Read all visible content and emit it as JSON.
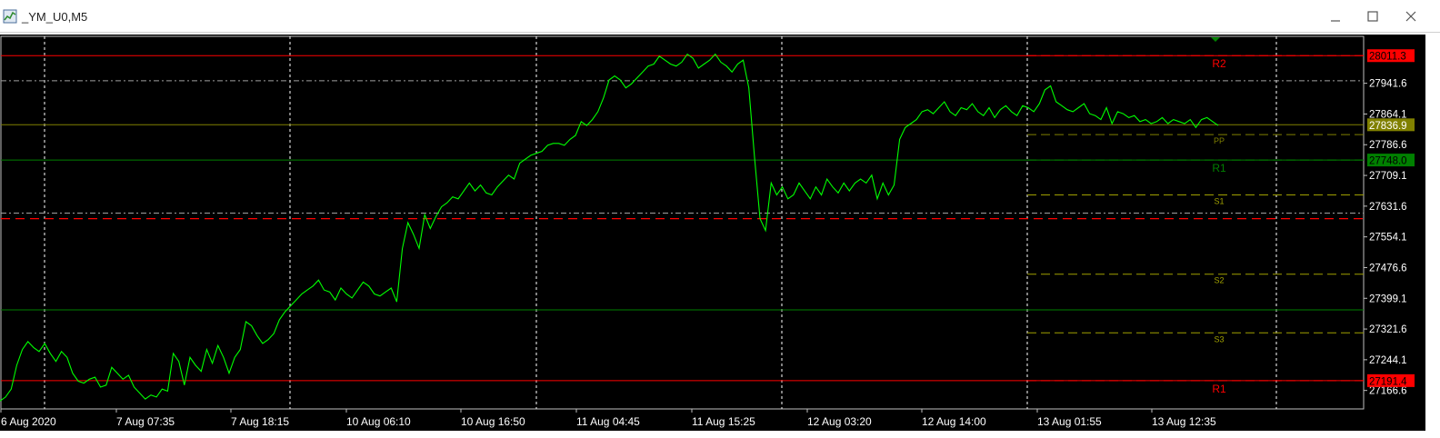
{
  "window": {
    "title": "_YM_U0,M5",
    "controls": {
      "minimize": "minimize",
      "maximize": "maximize",
      "close": "close"
    }
  },
  "colors": {
    "background": "#000000",
    "price_line": "#00ff00",
    "grid": "#ffffff",
    "resistance": "#ff0000",
    "support": "#008000",
    "pivot": "#808000",
    "fib": "#a0a000"
  },
  "chart_data": {
    "type": "line",
    "symbol": "_YM_U0",
    "timeframe": "M5",
    "ylim": [
      27120,
      28060
    ],
    "price_axis_ticks": [
      "27941.6",
      "27864.1",
      "27786.6",
      "27709.1",
      "27631.6",
      "27554.1",
      "27476.6",
      "27399.1",
      "27321.6",
      "27244.1",
      "27166.6"
    ],
    "price_tags": [
      {
        "text": "28011.3",
        "value": 28011.3,
        "color": "#ff0000",
        "text_color": "#000000"
      },
      {
        "text": "27836.9",
        "value": 27836.9,
        "color": "#808000",
        "text_color": "#ffffff"
      },
      {
        "text": "27748.0",
        "value": 27748.0,
        "color": "#008000",
        "text_color": "#000000"
      },
      {
        "text": "27191.4",
        "value": 27191.4,
        "color": "#ff0000",
        "text_color": "#000000"
      }
    ],
    "time_labels": [
      "6 Aug 2020",
      "7 Aug 07:35",
      "7 Aug 18:15",
      "10 Aug 06:10",
      "10 Aug 16:50",
      "11 Aug 04:45",
      "11 Aug 15:25",
      "12 Aug 03:20",
      "12 Aug 14:00",
      "13 Aug 01:55",
      "13 Aug 12:35"
    ],
    "horizontal_levels": [
      {
        "value": 28011.3,
        "color": "#ff0000",
        "style": "solid"
      },
      {
        "value": 27948,
        "color": "#a0a0a0",
        "style": "dashdot"
      },
      {
        "value": 27836.9,
        "color": "#808000",
        "style": "solid"
      },
      {
        "value": 27748.0,
        "color": "#008000",
        "style": "solid"
      },
      {
        "value": 27614,
        "color": "#a0a0a0",
        "style": "dashdot"
      },
      {
        "value": 27600,
        "color": "#ff0000",
        "style": "dashed"
      },
      {
        "value": 27370,
        "color": "#008000",
        "style": "solid"
      },
      {
        "value": 27191.4,
        "color": "#ff0000",
        "style": "solid"
      }
    ],
    "pivot_levels": [
      {
        "label": "R2",
        "value": 28011.3,
        "color": "#ff0000",
        "label_size": "large"
      },
      {
        "label": "PP",
        "value": 27812,
        "color": "#808000",
        "label_size": "small"
      },
      {
        "label": "R1",
        "value": 27748.0,
        "color": "#008000",
        "label_size": "large"
      },
      {
        "label": "S1",
        "value": 27660,
        "color": "#a0a000",
        "label_size": "small"
      },
      {
        "label": "S2",
        "value": 27460,
        "color": "#a0a000",
        "label_size": "small"
      },
      {
        "label": "S3",
        "value": 27312,
        "color": "#a0a000",
        "label_size": "small"
      },
      {
        "label": "R1",
        "value": 27191.4,
        "color": "#ff0000",
        "label_size": "large"
      }
    ],
    "series": [
      {
        "values": [
          27140,
          27150,
          27170,
          27230,
          27270,
          27290,
          27275,
          27265,
          27285,
          27260,
          27240,
          27265,
          27250,
          27210,
          27190,
          27185,
          27195,
          27200,
          27175,
          27180,
          27225,
          27210,
          27195,
          27205,
          27175,
          27160,
          27145,
          27155,
          27150,
          27170,
          27165,
          27260,
          27240,
          27180,
          27250,
          27230,
          27215,
          27270,
          27235,
          27280,
          27250,
          27210,
          27250,
          27270,
          27340,
          27330,
          27305,
          27285,
          27295,
          27310,
          27345,
          27365,
          27380,
          27395,
          27410,
          27420,
          27430,
          27445,
          27420,
          27415,
          27395,
          27425,
          27410,
          27400,
          27420,
          27440,
          27430,
          27410,
          27405,
          27415,
          27425,
          27390,
          27525,
          27590,
          27560,
          27525,
          27610,
          27575,
          27605,
          27630,
          27640,
          27655,
          27650,
          27670,
          27690,
          27670,
          27685,
          27665,
          27660,
          27680,
          27695,
          27710,
          27700,
          27740,
          27750,
          27760,
          27765,
          27770,
          27785,
          27790,
          27790,
          27785,
          27800,
          27810,
          27845,
          27835,
          27850,
          27870,
          27905,
          27950,
          27960,
          27950,
          27930,
          27940,
          27955,
          27970,
          27985,
          27990,
          28010,
          28000,
          27990,
          27985,
          27995,
          28015,
          28005,
          27980,
          27990,
          28000,
          28015,
          27995,
          27985,
          27970,
          27990,
          28000,
          27930,
          27760,
          27600,
          27570,
          27690,
          27660,
          27680,
          27650,
          27660,
          27690,
          27670,
          27650,
          27680,
          27660,
          27700,
          27680,
          27665,
          27690,
          27670,
          27690,
          27700,
          27690,
          27710,
          27650,
          27690,
          27660,
          27685,
          27800,
          27830,
          27840,
          27850,
          27870,
          27875,
          27865,
          27880,
          27895,
          27870,
          27860,
          27880,
          27875,
          27890,
          27870,
          27860,
          27880,
          27855,
          27875,
          27885,
          27870,
          27860,
          27885,
          27880,
          27870,
          27890,
          27925,
          27935,
          27895,
          27885,
          27875,
          27870,
          27880,
          27890,
          27865,
          27860,
          27850,
          27880,
          27840,
          27870,
          27865,
          27855,
          27860,
          27845,
          27850,
          27840,
          27845,
          27855,
          27840,
          27850,
          27845,
          27840,
          27850,
          27830,
          27850,
          27855,
          27845,
          27835
        ]
      }
    ]
  }
}
